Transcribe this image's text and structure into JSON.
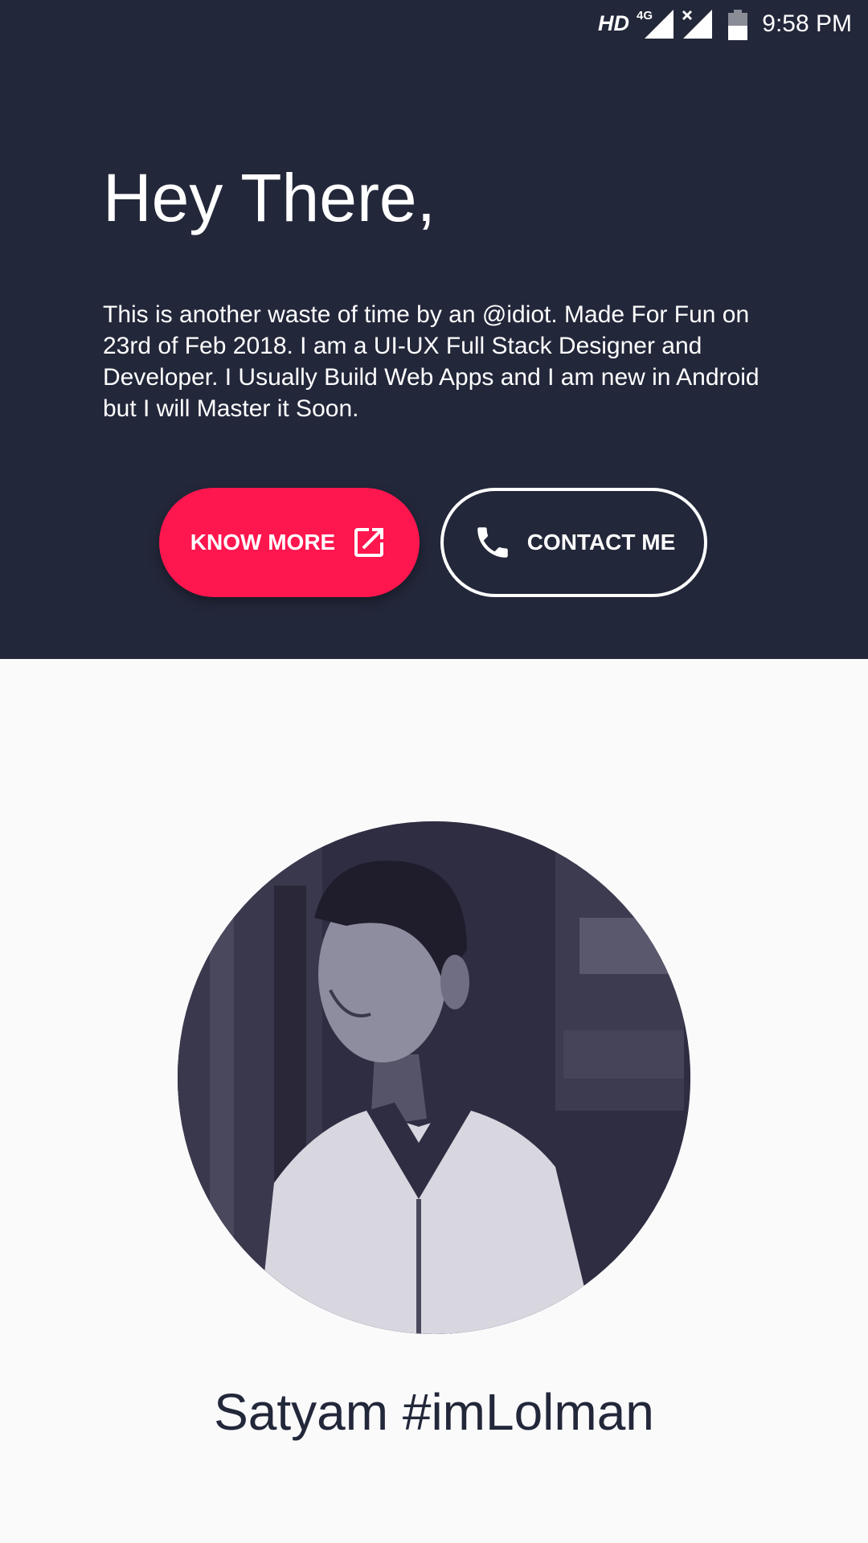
{
  "status_bar": {
    "network_label": "HD",
    "network_type": "4G",
    "time": "9:58 PM"
  },
  "hero": {
    "title": "Hey There,",
    "description": "This is another waste of time by an @idiot. Made For Fun on 23rd of Feb 2018. I am a UI-UX Full Stack Designer and Developer. I Usually Build Web Apps and I am new in Android but I will Master it Soon.",
    "know_more_label": "KNOW MORE",
    "contact_label": "CONTACT ME"
  },
  "profile": {
    "name": "Satyam #imLolman"
  },
  "colors": {
    "hero_background": "#23273a",
    "accent": "#fe164e",
    "page_background": "#fafafb",
    "name_text": "#23273a"
  },
  "icons": {
    "know_more": "open-in-new-icon",
    "contact": "phone-icon"
  }
}
